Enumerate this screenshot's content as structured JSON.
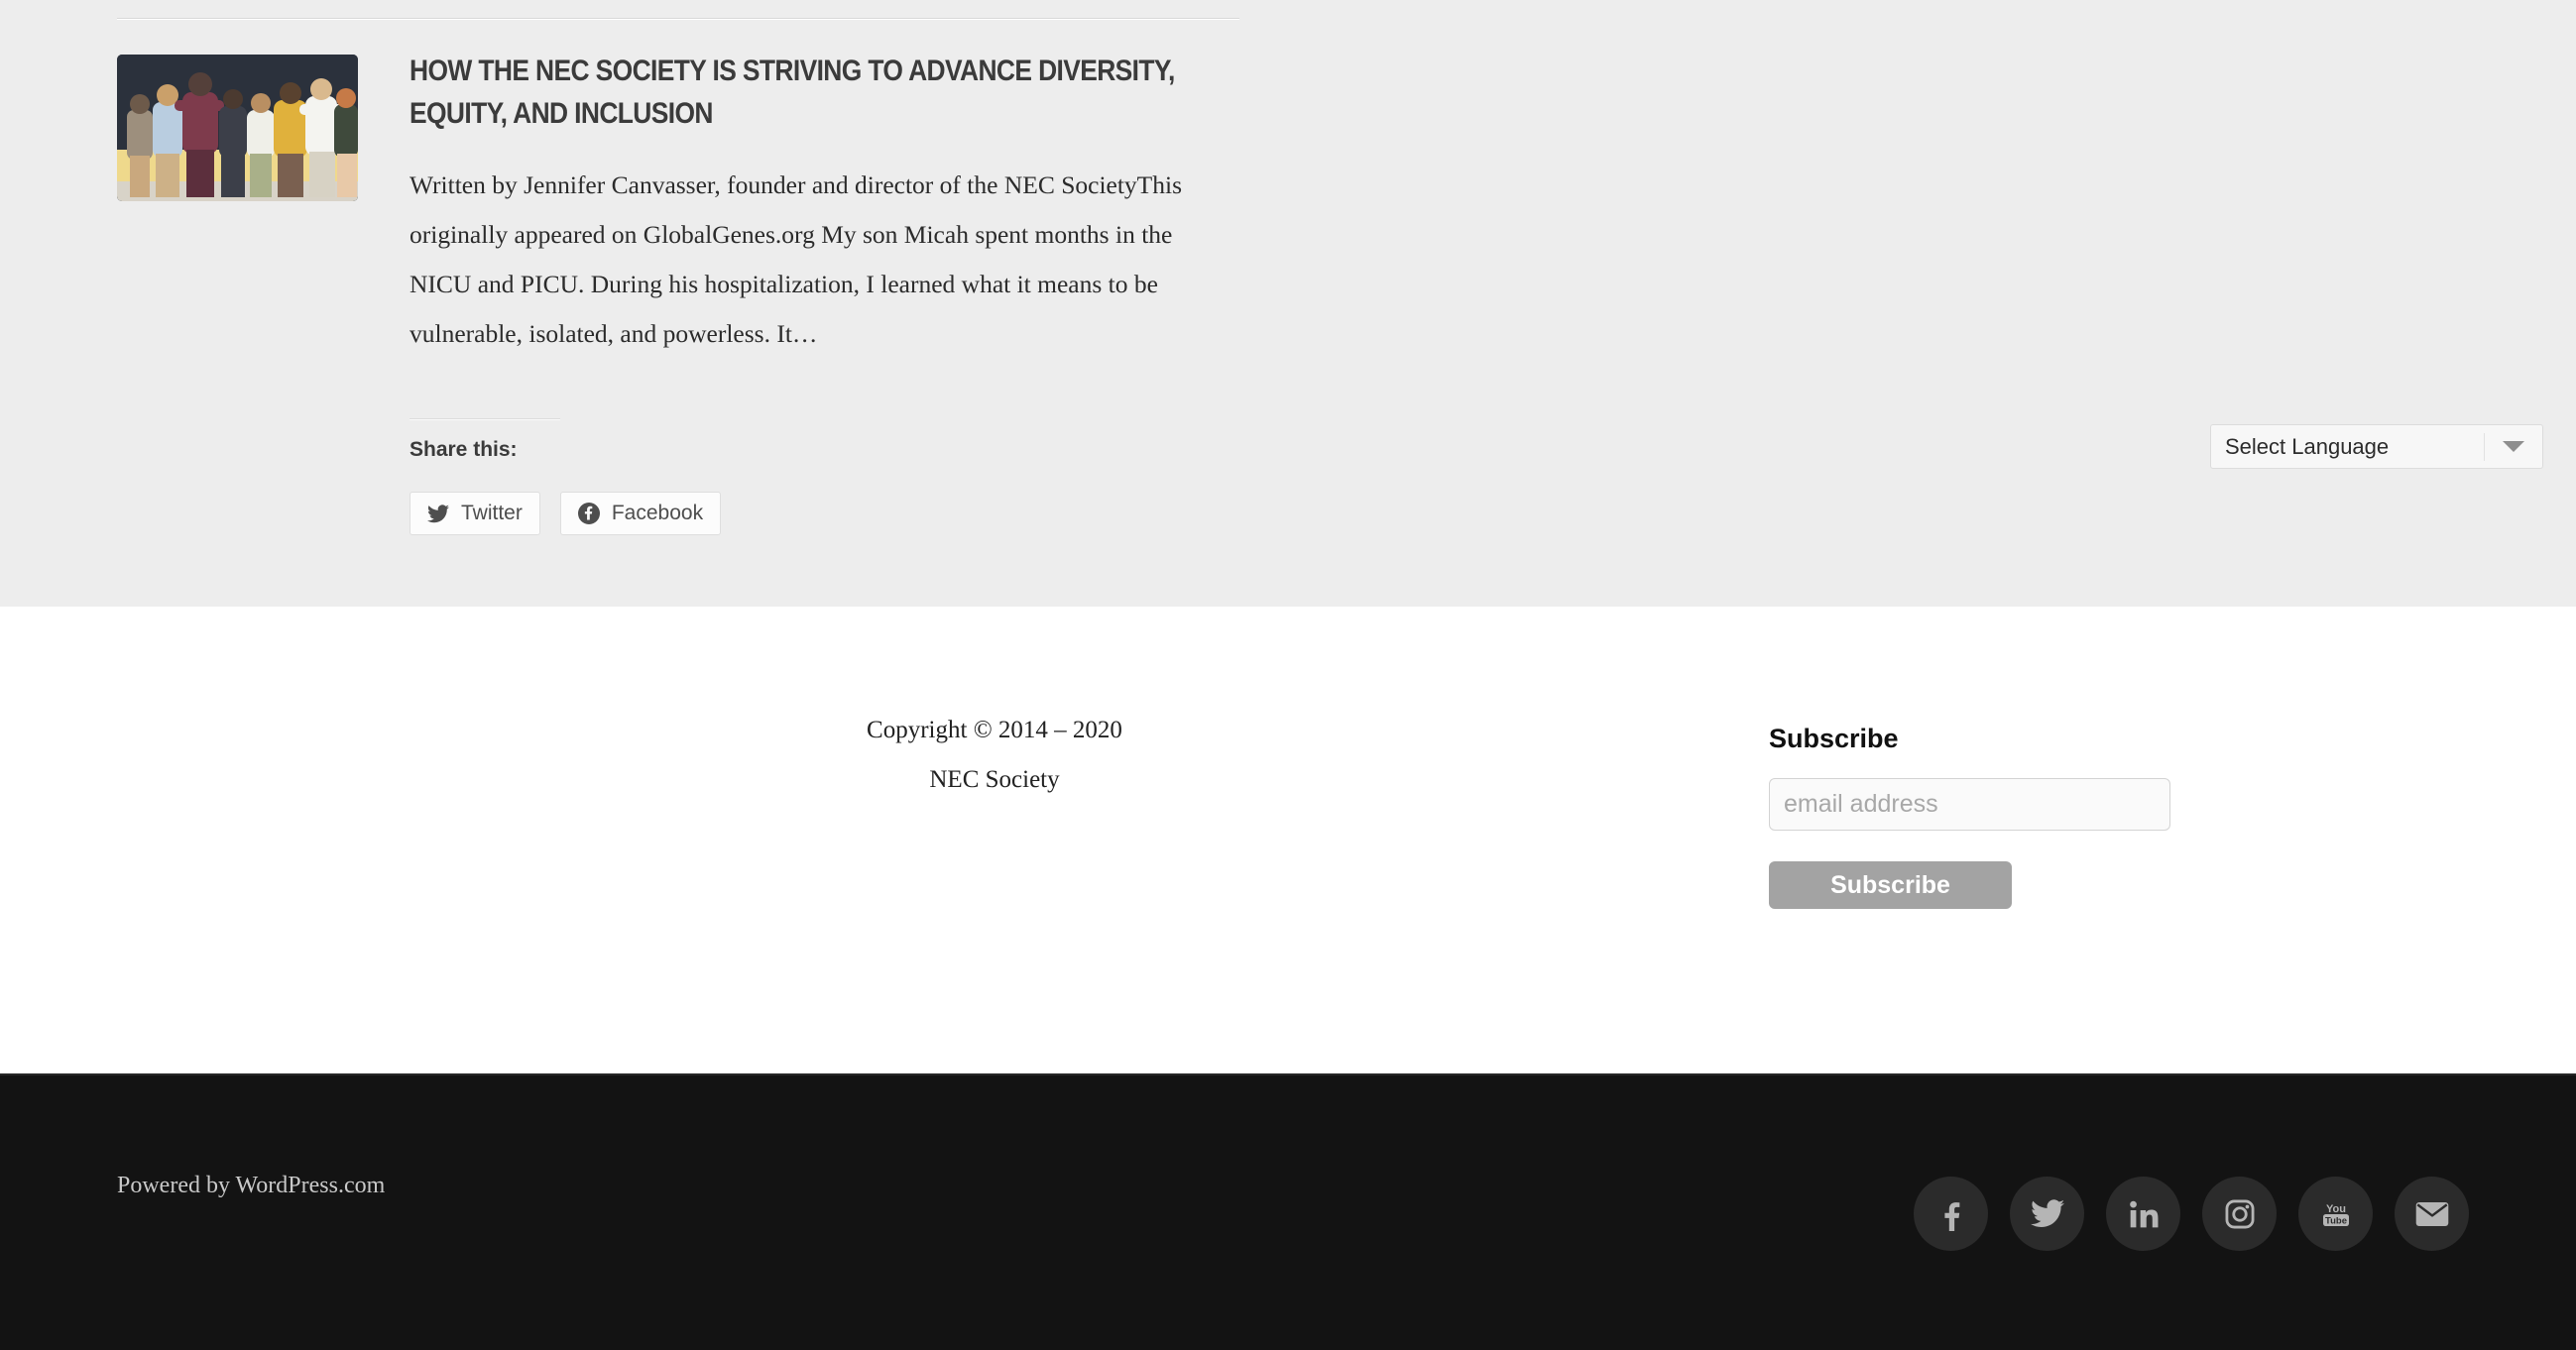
{
  "article": {
    "title": "HOW THE NEC SOCIETY IS STRIVING TO ADVANCE DIVERSITY, EQUITY, AND INCLUSION",
    "excerpt": "Written by Jennifer Canvasser, founder and director of the NEC SocietyThis originally appeared on GlobalGenes.org My son Micah spent months in the NICU and PICU. During his hospitalization, I learned what it means to be vulnerable, isolated, and powerless. It…",
    "thumbnail_alt": "group-of-people-embracing-photo",
    "share": {
      "label": "Share this:",
      "buttons": [
        {
          "label": "Twitter",
          "icon": "twitter-icon"
        },
        {
          "label": "Facebook",
          "icon": "facebook-icon"
        }
      ]
    }
  },
  "language_select": {
    "value": "Select Language",
    "icon": "chevron-down-icon"
  },
  "footer_white": {
    "copyright_line1": "Copyright © 2014 – 2020",
    "copyright_line2": "NEC Society",
    "subscribe": {
      "heading": "Subscribe",
      "email_value": "",
      "email_placeholder": "email address",
      "button_label": "Subscribe"
    }
  },
  "footer_dark": {
    "credit": "Powered by WordPress.com",
    "social": [
      {
        "name": "facebook-icon"
      },
      {
        "name": "twitter-icon"
      },
      {
        "name": "linkedin-icon"
      },
      {
        "name": "instagram-icon"
      },
      {
        "name": "youtube-icon"
      },
      {
        "name": "email-icon"
      }
    ]
  },
  "colors": {
    "article_bg": "#ededed",
    "mid_bg": "#ffffff",
    "footer_bg": "#131313",
    "subscribe_button": "#a3a3a3",
    "social_circle": "#2b2b2b"
  }
}
